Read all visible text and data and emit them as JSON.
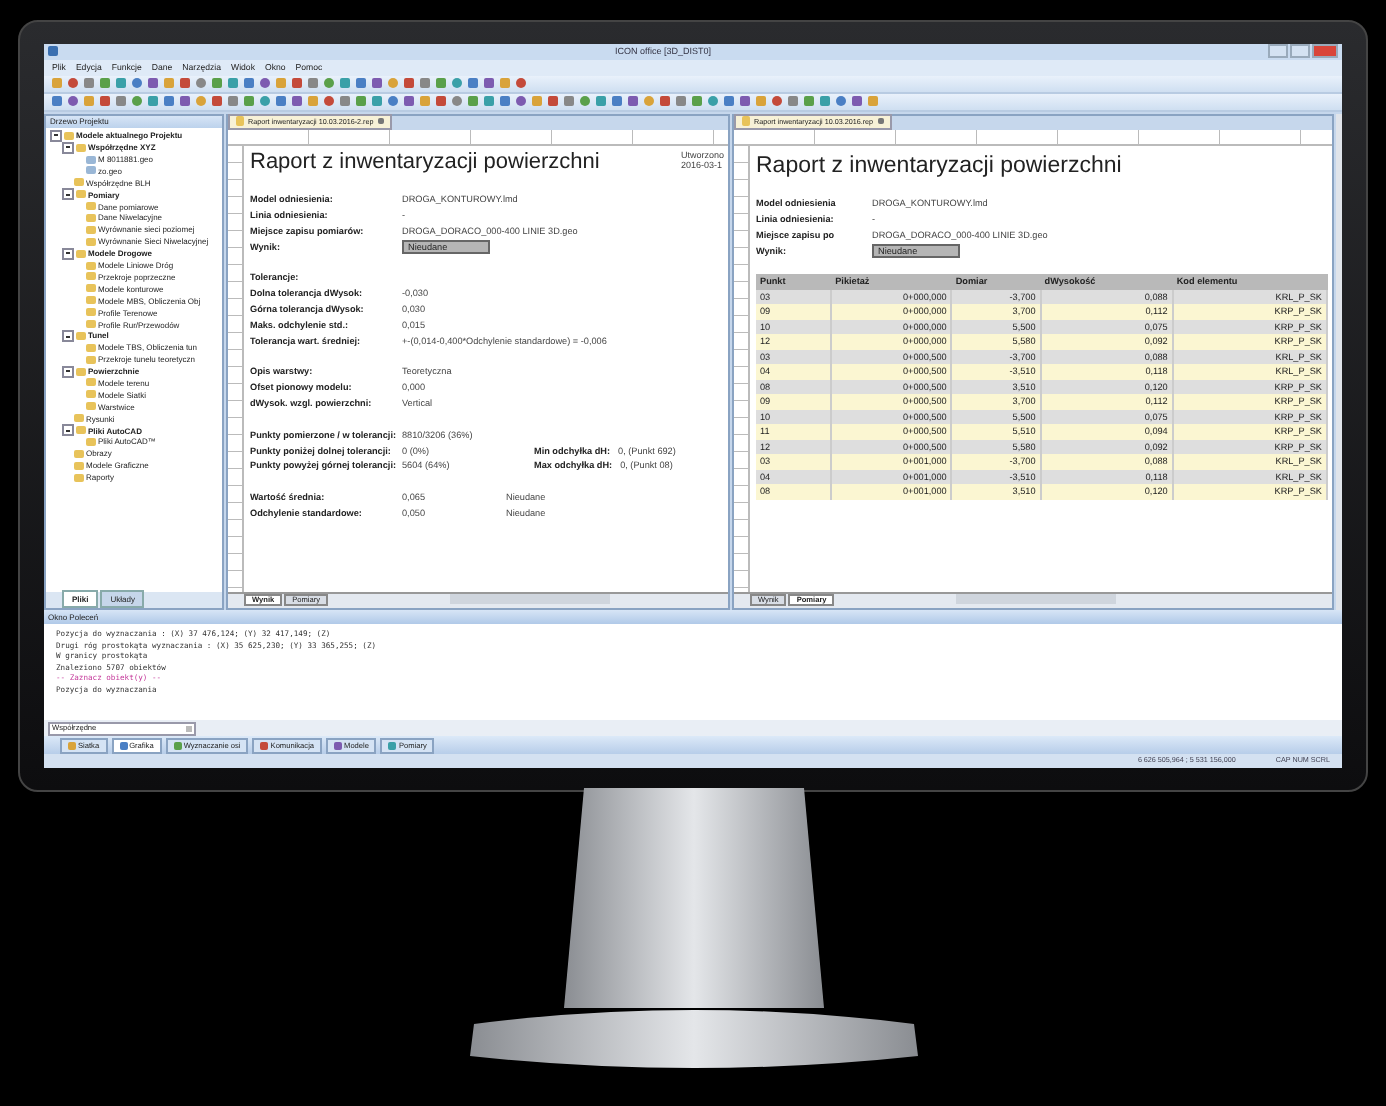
{
  "window": {
    "title": "ICON office [3D_DIST0]"
  },
  "menu": [
    "Plik",
    "Edycja",
    "Funkcje",
    "Dane",
    "Narzędzia",
    "Widok",
    "Okno",
    "Pomoc"
  ],
  "project_tree": {
    "title": "Drzewo Projektu",
    "items": [
      {
        "label": "Modele aktualnego Projektu",
        "expanded": true,
        "children": [
          {
            "label": "Współrzędne XYZ",
            "expanded": true,
            "children": [
              {
                "label": "M 8011881.geo"
              },
              {
                "label": "zo.geo"
              }
            ]
          },
          {
            "label": "Współrzędne BLH"
          },
          {
            "label": "Pomiary",
            "expanded": true,
            "children": [
              {
                "label": "Dane pomiarowe"
              },
              {
                "label": "Dane Niwelacyjne"
              },
              {
                "label": "Wyrównanie sieci poziomej"
              },
              {
                "label": "Wyrównanie Sieci Niwelacyjnej"
              }
            ]
          },
          {
            "label": "Modele Drogowe",
            "expanded": true,
            "children": [
              {
                "label": "Modele Liniowe Dróg"
              },
              {
                "label": "Przekroje poprzeczne"
              },
              {
                "label": "Modele konturowe"
              },
              {
                "label": "Modele MBS, Obliczenia Obj"
              },
              {
                "label": "Profile Terenowe"
              },
              {
                "label": "Profile Rur/Przewodów"
              }
            ]
          },
          {
            "label": "Tunel",
            "expanded": true,
            "children": [
              {
                "label": "Modele TBS, Obliczenia tun"
              },
              {
                "label": "Przekroje tunelu teoretyczn"
              }
            ]
          },
          {
            "label": "Powierzchnie",
            "expanded": true,
            "children": [
              {
                "label": "Modele terenu"
              },
              {
                "label": "Modele Siatki"
              },
              {
                "label": "Warstwice"
              }
            ]
          },
          {
            "label": "Rysunki"
          },
          {
            "label": "Pliki AutoCAD",
            "expanded": true,
            "children": [
              {
                "label": "Pliki AutoCAD™"
              }
            ]
          },
          {
            "label": "Obrazy"
          },
          {
            "label": "Modele Graficzne"
          },
          {
            "label": "Raporty"
          }
        ]
      }
    ],
    "tabs": [
      {
        "label": "Pliki",
        "selected": true
      },
      {
        "label": "Układy",
        "selected": false
      }
    ]
  },
  "report_left": {
    "tab": "Raport inwentaryzacji 10.03.2016-2.rep",
    "title": "Raport z inwentaryzacji powierzchni",
    "created_label": "Utworzono",
    "created_value": "2016-03-1",
    "groups": [
      [
        {
          "label": "Model odniesienia:",
          "value": "DROGA_KONTUROWY.lmd"
        },
        {
          "label": "Linia odniesienia:",
          "value": "-"
        },
        {
          "label": "Miejsce zapisu pomiarów:",
          "value": "DROGA_DORACO_000-400 LINIE 3D.geo"
        },
        {
          "label": "Wynik:",
          "value": "Nieudane",
          "boxed": true
        }
      ],
      [
        {
          "label": "Tolerancje:"
        },
        {
          "label": "Dolna tolerancja dWysok:",
          "value": "-0,030"
        },
        {
          "label": "Górna tolerancja dWysok:",
          "value": "0,030"
        },
        {
          "label": "Maks. odchylenie std.:",
          "value": "0,015"
        },
        {
          "label": "Tolerancja wart. średniej:",
          "value": "+-(0,014-0,400*Odchylenie standardowe) = -0,006"
        }
      ],
      [
        {
          "label": "Opis warstwy:",
          "value": "Teoretyczna"
        },
        {
          "label": "Ofset pionowy modelu:",
          "value": "0,000"
        },
        {
          "label": "dWysok. wzgl. powierzchni:",
          "value": "Vertical"
        }
      ],
      [
        {
          "label": "Punkty pomierzone / w tolerancji:",
          "value": "8810/3206 (36%)"
        },
        {
          "label": "Punkty poniżej dolnej tolerancji:",
          "value": "0 (0%)",
          "side_label": "Min odchyłka dH:",
          "side_value": "0,  (Punkt 692)"
        },
        {
          "label": "Punkty powyżej górnej tolerancji:",
          "value": "5604 (64%)",
          "side_label": "Max odchyłka dH:",
          "side_value": "0,  (Punkt 08)"
        }
      ],
      [
        {
          "label": "Wartość średnia:",
          "value": "0,065",
          "status": "Nieudane"
        },
        {
          "label": "Odchylenie standardowe:",
          "value": "0,050",
          "status": "Nieudane"
        }
      ]
    ],
    "sheets": [
      {
        "label": "Wynik",
        "selected": true
      },
      {
        "label": "Pomiary",
        "selected": false
      }
    ]
  },
  "report_right": {
    "tab": "Raport inwentaryzacji 10.03.2016.rep",
    "title": "Raport z inwentaryzacji powierzchni",
    "info": [
      {
        "label": "Model odniesienia",
        "value": "DROGA_KONTUROWY.lmd"
      },
      {
        "label": "Linia odniesienia:",
        "value": "-"
      },
      {
        "label": "Miejsce zapisu po",
        "value": "DROGA_DORACO_000-400 LINIE 3D.geo"
      },
      {
        "label": "Wynik:",
        "value": "Nieudane",
        "boxed": true
      }
    ],
    "table": {
      "columns": [
        "Punkt",
        "Pikietaż",
        "Domiar",
        "dWysokość",
        "Kod elementu"
      ],
      "rows": [
        [
          "03",
          "0+000,000",
          "-3,700",
          "0,088",
          "KRL_P_SK"
        ],
        [
          "09",
          "0+000,000",
          "3,700",
          "0,112",
          "KRP_P_SK"
        ],
        [
          "10",
          "0+000,000",
          "5,500",
          "0,075",
          "KRP_P_SK"
        ],
        [
          "12",
          "0+000,000",
          "5,580",
          "0,092",
          "KRP_P_SK"
        ],
        [
          "03",
          "0+000,500",
          "-3,700",
          "0,088",
          "KRL_P_SK"
        ],
        [
          "04",
          "0+000,500",
          "-3,510",
          "0,118",
          "KRL_P_SK"
        ],
        [
          "08",
          "0+000,500",
          "3,510",
          "0,120",
          "KRP_P_SK"
        ],
        [
          "09",
          "0+000,500",
          "3,700",
          "0,112",
          "KRP_P_SK"
        ],
        [
          "10",
          "0+000,500",
          "5,500",
          "0,075",
          "KRP_P_SK"
        ],
        [
          "11",
          "0+000,500",
          "5,510",
          "0,094",
          "KRP_P_SK"
        ],
        [
          "12",
          "0+000,500",
          "5,580",
          "0,092",
          "KRP_P_SK"
        ],
        [
          "03",
          "0+001,000",
          "-3,700",
          "0,088",
          "KRL_P_SK"
        ],
        [
          "04",
          "0+001,000",
          "-3,510",
          "0,118",
          "KRL_P_SK"
        ],
        [
          "08",
          "0+001,000",
          "3,510",
          "0,120",
          "KRP_P_SK"
        ]
      ]
    },
    "sheets": [
      {
        "label": "Wynik",
        "selected": false
      },
      {
        "label": "Pomiary",
        "selected": true
      }
    ]
  },
  "command_window": {
    "title": "Okno Poleceń",
    "lines": [
      {
        "text": "Pozycja do wyznaczania   : (X) 37 476,124; (Y) 32 417,149; (Z)",
        "kind": "normal"
      },
      {
        "text": "Drugi róg prostokąta wyznaczania  : (X) 35 625,230; (Y) 33 365,255; (Z)",
        "kind": "normal"
      },
      {
        "text": "W granicy prostokąta",
        "kind": "normal"
      },
      {
        "text": "Znaleziono 5707 obiektów",
        "kind": "normal"
      },
      {
        "text": "-- Zaznacz obiekt(y) --",
        "kind": "prompt"
      },
      {
        "text": "Pozycja do wyznaczania",
        "kind": "normal"
      }
    ],
    "input": {
      "value": "Współrzędne"
    }
  },
  "ribbon_tabs": [
    {
      "label": "Siatka",
      "selected": false
    },
    {
      "label": "Grafika",
      "selected": true
    },
    {
      "label": "Wyznaczanie osi",
      "selected": false
    },
    {
      "label": "Komunikacja",
      "selected": false
    },
    {
      "label": "Modele",
      "selected": false
    },
    {
      "label": "Pomiary",
      "selected": false
    }
  ],
  "status_bar": {
    "coordinates": "6 626 505,964 ; 5 531 156,000",
    "indicators": "CAP NUM SCRL"
  }
}
